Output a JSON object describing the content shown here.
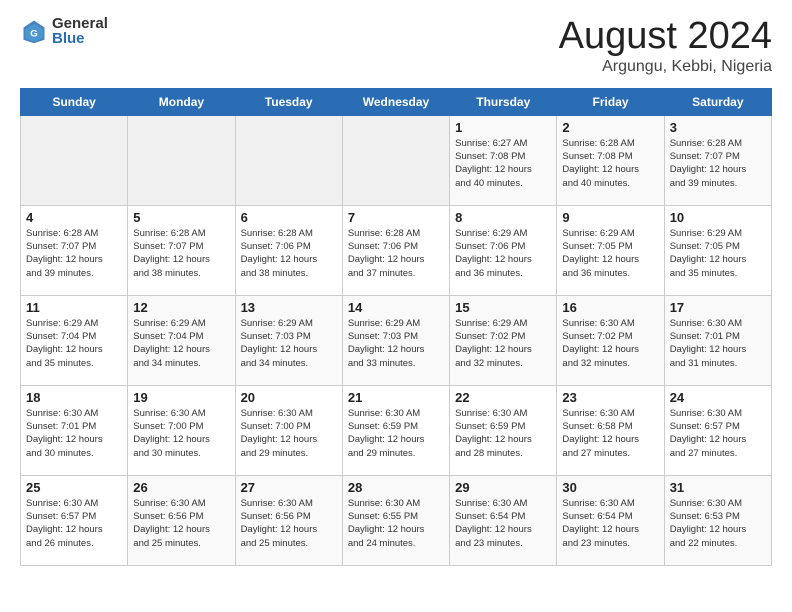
{
  "logo": {
    "general": "General",
    "blue": "Blue"
  },
  "title": "August 2024",
  "subtitle": "Argungu, Kebbi, Nigeria",
  "days_of_week": [
    "Sunday",
    "Monday",
    "Tuesday",
    "Wednesday",
    "Thursday",
    "Friday",
    "Saturday"
  ],
  "weeks": [
    [
      {
        "day": "",
        "info": ""
      },
      {
        "day": "",
        "info": ""
      },
      {
        "day": "",
        "info": ""
      },
      {
        "day": "",
        "info": ""
      },
      {
        "day": "1",
        "info": "Sunrise: 6:27 AM\nSunset: 7:08 PM\nDaylight: 12 hours\nand 40 minutes."
      },
      {
        "day": "2",
        "info": "Sunrise: 6:28 AM\nSunset: 7:08 PM\nDaylight: 12 hours\nand 40 minutes."
      },
      {
        "day": "3",
        "info": "Sunrise: 6:28 AM\nSunset: 7:07 PM\nDaylight: 12 hours\nand 39 minutes."
      }
    ],
    [
      {
        "day": "4",
        "info": "Sunrise: 6:28 AM\nSunset: 7:07 PM\nDaylight: 12 hours\nand 39 minutes."
      },
      {
        "day": "5",
        "info": "Sunrise: 6:28 AM\nSunset: 7:07 PM\nDaylight: 12 hours\nand 38 minutes."
      },
      {
        "day": "6",
        "info": "Sunrise: 6:28 AM\nSunset: 7:06 PM\nDaylight: 12 hours\nand 38 minutes."
      },
      {
        "day": "7",
        "info": "Sunrise: 6:28 AM\nSunset: 7:06 PM\nDaylight: 12 hours\nand 37 minutes."
      },
      {
        "day": "8",
        "info": "Sunrise: 6:29 AM\nSunset: 7:06 PM\nDaylight: 12 hours\nand 36 minutes."
      },
      {
        "day": "9",
        "info": "Sunrise: 6:29 AM\nSunset: 7:05 PM\nDaylight: 12 hours\nand 36 minutes."
      },
      {
        "day": "10",
        "info": "Sunrise: 6:29 AM\nSunset: 7:05 PM\nDaylight: 12 hours\nand 35 minutes."
      }
    ],
    [
      {
        "day": "11",
        "info": "Sunrise: 6:29 AM\nSunset: 7:04 PM\nDaylight: 12 hours\nand 35 minutes."
      },
      {
        "day": "12",
        "info": "Sunrise: 6:29 AM\nSunset: 7:04 PM\nDaylight: 12 hours\nand 34 minutes."
      },
      {
        "day": "13",
        "info": "Sunrise: 6:29 AM\nSunset: 7:03 PM\nDaylight: 12 hours\nand 34 minutes."
      },
      {
        "day": "14",
        "info": "Sunrise: 6:29 AM\nSunset: 7:03 PM\nDaylight: 12 hours\nand 33 minutes."
      },
      {
        "day": "15",
        "info": "Sunrise: 6:29 AM\nSunset: 7:02 PM\nDaylight: 12 hours\nand 32 minutes."
      },
      {
        "day": "16",
        "info": "Sunrise: 6:30 AM\nSunset: 7:02 PM\nDaylight: 12 hours\nand 32 minutes."
      },
      {
        "day": "17",
        "info": "Sunrise: 6:30 AM\nSunset: 7:01 PM\nDaylight: 12 hours\nand 31 minutes."
      }
    ],
    [
      {
        "day": "18",
        "info": "Sunrise: 6:30 AM\nSunset: 7:01 PM\nDaylight: 12 hours\nand 30 minutes."
      },
      {
        "day": "19",
        "info": "Sunrise: 6:30 AM\nSunset: 7:00 PM\nDaylight: 12 hours\nand 30 minutes."
      },
      {
        "day": "20",
        "info": "Sunrise: 6:30 AM\nSunset: 7:00 PM\nDaylight: 12 hours\nand 29 minutes."
      },
      {
        "day": "21",
        "info": "Sunrise: 6:30 AM\nSunset: 6:59 PM\nDaylight: 12 hours\nand 29 minutes."
      },
      {
        "day": "22",
        "info": "Sunrise: 6:30 AM\nSunset: 6:59 PM\nDaylight: 12 hours\nand 28 minutes."
      },
      {
        "day": "23",
        "info": "Sunrise: 6:30 AM\nSunset: 6:58 PM\nDaylight: 12 hours\nand 27 minutes."
      },
      {
        "day": "24",
        "info": "Sunrise: 6:30 AM\nSunset: 6:57 PM\nDaylight: 12 hours\nand 27 minutes."
      }
    ],
    [
      {
        "day": "25",
        "info": "Sunrise: 6:30 AM\nSunset: 6:57 PM\nDaylight: 12 hours\nand 26 minutes."
      },
      {
        "day": "26",
        "info": "Sunrise: 6:30 AM\nSunset: 6:56 PM\nDaylight: 12 hours\nand 25 minutes."
      },
      {
        "day": "27",
        "info": "Sunrise: 6:30 AM\nSunset: 6:56 PM\nDaylight: 12 hours\nand 25 minutes."
      },
      {
        "day": "28",
        "info": "Sunrise: 6:30 AM\nSunset: 6:55 PM\nDaylight: 12 hours\nand 24 minutes."
      },
      {
        "day": "29",
        "info": "Sunrise: 6:30 AM\nSunset: 6:54 PM\nDaylight: 12 hours\nand 23 minutes."
      },
      {
        "day": "30",
        "info": "Sunrise: 6:30 AM\nSunset: 6:54 PM\nDaylight: 12 hours\nand 23 minutes."
      },
      {
        "day": "31",
        "info": "Sunrise: 6:30 AM\nSunset: 6:53 PM\nDaylight: 12 hours\nand 22 minutes."
      }
    ]
  ]
}
